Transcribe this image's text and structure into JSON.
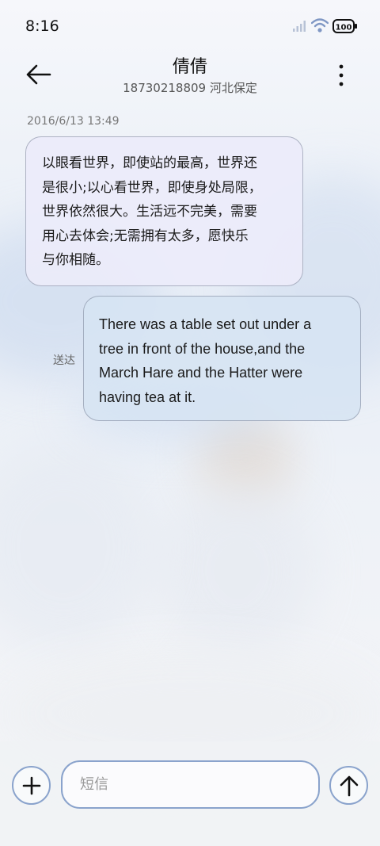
{
  "status_bar": {
    "time": "8:16",
    "battery": "100"
  },
  "header": {
    "contact_name": "倩倩",
    "contact_detail": "18730218809 河北保定"
  },
  "conversation": {
    "date": "2016/6/13 13:49",
    "messages": [
      {
        "direction": "incoming",
        "lines": [
          "以眼看世界，即使站的最高，世界还",
          "是很小;以心看世界，即使身处局限，",
          "世界依然很大。生活远不完美，需要",
          "用心去体会;无需拥有太多，愿快乐",
          "与你相随。"
        ]
      },
      {
        "direction": "outgoing",
        "lines": [
          "There was a table set out under a",
          "tree in front of the house,and the",
          "March Hare and the Hatter were",
          "having tea at it."
        ],
        "status": "送达"
      }
    ]
  },
  "composer": {
    "placeholder": "短信"
  },
  "colors": {
    "accent_border": "#8aa3cc",
    "incoming_bubble": "#ececfa",
    "outgoing_bubble": "#d6e4f3"
  },
  "icons": [
    "signal-icon",
    "wifi-icon",
    "battery-icon",
    "back-arrow-icon",
    "more-vert-icon",
    "plus-icon",
    "send-arrow-up-icon"
  ]
}
